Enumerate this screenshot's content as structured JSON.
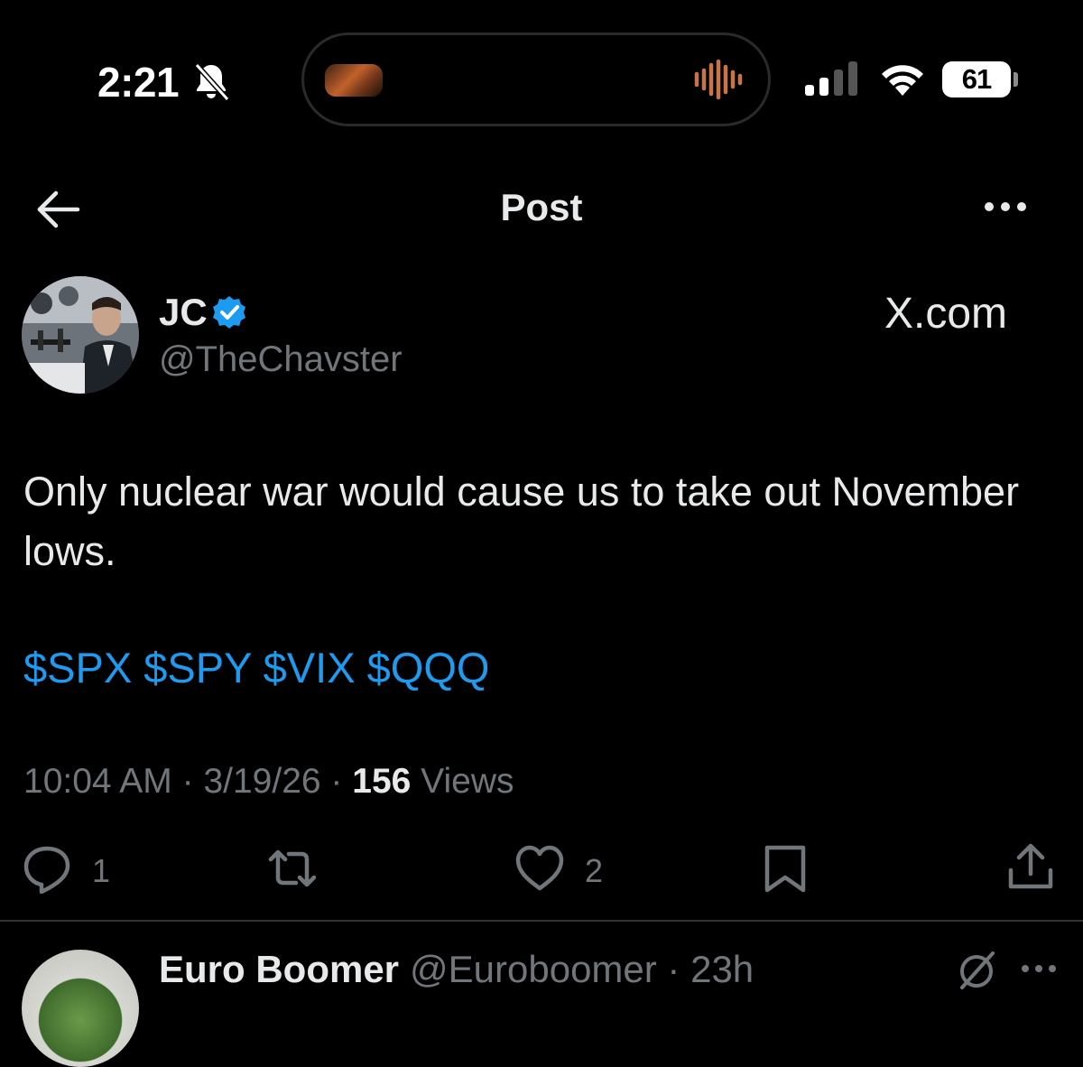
{
  "status_bar": {
    "time": "2:21",
    "battery": "61",
    "icons": [
      "bell-slash-icon",
      "audio-wave-icon",
      "cellular-signal-icon",
      "wifi-icon",
      "battery-icon"
    ]
  },
  "header": {
    "title": "Post",
    "back_icon": "arrow-left-icon",
    "more_icon": "ellipsis-icon"
  },
  "post": {
    "author": {
      "name": "JC",
      "handle": "@TheChavster",
      "verified": true
    },
    "brand": "X.com",
    "text": "Only nuclear war would cause us to take out November lows.",
    "cashtags": [
      "$SPX",
      "$SPY",
      "$VIX",
      "$QQQ"
    ],
    "time": "10:04 AM",
    "date": "3/19/26",
    "views_count": "156",
    "views_label": "Views",
    "actions": {
      "replies": "1",
      "likes": "2"
    }
  },
  "reply": {
    "name": "Euro Boomer",
    "handle": "@Euroboomer",
    "age": "23h"
  },
  "colors": {
    "background": "#000000",
    "text": "#e7e9ea",
    "muted": "#71767b",
    "link": "#1d9bf0",
    "divider": "#2f3336"
  }
}
